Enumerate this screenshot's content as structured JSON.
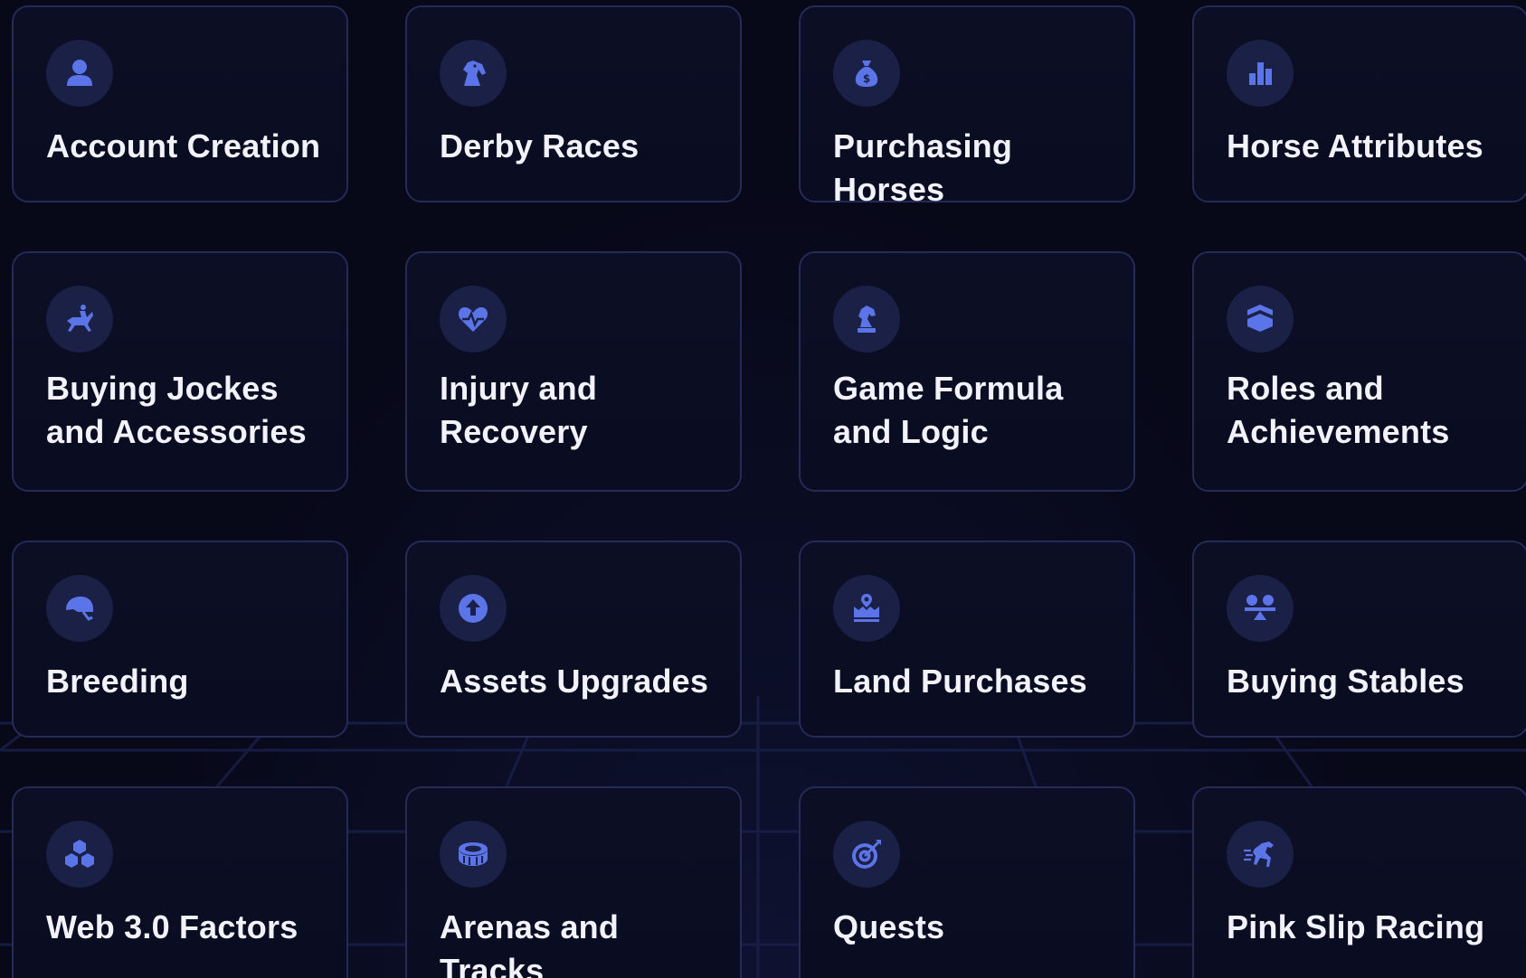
{
  "colors": {
    "background": "#070818",
    "card_border": "#252a57",
    "icon_circle": "#1b2046",
    "icon_accent": "#5b74e8",
    "text": "#f2f3fa"
  },
  "features": [
    {
      "label": "Account Creation",
      "icon": "user-icon"
    },
    {
      "label": "Derby Races",
      "icon": "horse-head-icon"
    },
    {
      "label": "Purchasing Horses",
      "icon": "money-bag-icon"
    },
    {
      "label": "Horse Attributes",
      "icon": "bar-chart-icon"
    },
    {
      "label": "Buying Jockes\nand Accessories",
      "icon": "horse-rider-icon"
    },
    {
      "label": "Injury and\nRecovery",
      "icon": "heart-pulse-icon"
    },
    {
      "label": "Game Formula\nand Logic",
      "icon": "chess-knight-icon"
    },
    {
      "label": "Roles and\nAchievements",
      "icon": "chevron-badge-icon"
    },
    {
      "label": "Breeding",
      "icon": "riding-helmet-icon"
    },
    {
      "label": "Assets Upgrades",
      "icon": "arrow-up-circle-icon"
    },
    {
      "label": "Land Purchases",
      "icon": "land-pin-icon"
    },
    {
      "label": "Buying Stables",
      "icon": "people-balance-icon"
    },
    {
      "label": "Web 3.0 Factors",
      "icon": "cubes-icon"
    },
    {
      "label": "Arenas and Tracks",
      "icon": "stadium-icon"
    },
    {
      "label": "Quests",
      "icon": "target-icon"
    },
    {
      "label": "Pink Slip Racing",
      "icon": "fast-horse-icon"
    }
  ]
}
